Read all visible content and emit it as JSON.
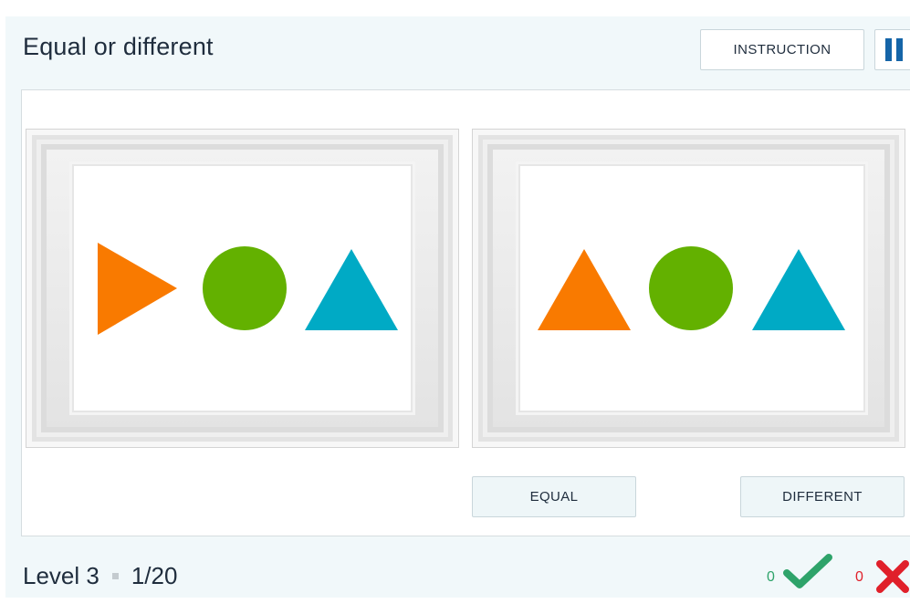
{
  "header": {
    "title": "Equal or different",
    "instruction_label": "INSTRUCTION",
    "pause_icon": "pause-icon"
  },
  "left_picture": {
    "shapes": [
      {
        "shape": "triangle-right",
        "color": "#f97a00"
      },
      {
        "shape": "circle",
        "color": "#63b100"
      },
      {
        "shape": "triangle-up",
        "color": "#00aac5"
      }
    ]
  },
  "right_picture": {
    "shapes": [
      {
        "shape": "triangle-up",
        "color": "#f97a00"
      },
      {
        "shape": "circle",
        "color": "#63b100"
      },
      {
        "shape": "triangle-up",
        "color": "#00aac5"
      }
    ]
  },
  "answers": {
    "equal_label": "EQUAL",
    "different_label": "DIFFERENT"
  },
  "footer": {
    "level": "Level 3",
    "progress": "1/20",
    "correct_count": "0",
    "wrong_count": "0"
  },
  "colors": {
    "accent": "#1565a8",
    "correct": "#2ea36a",
    "wrong": "#e0202a"
  }
}
